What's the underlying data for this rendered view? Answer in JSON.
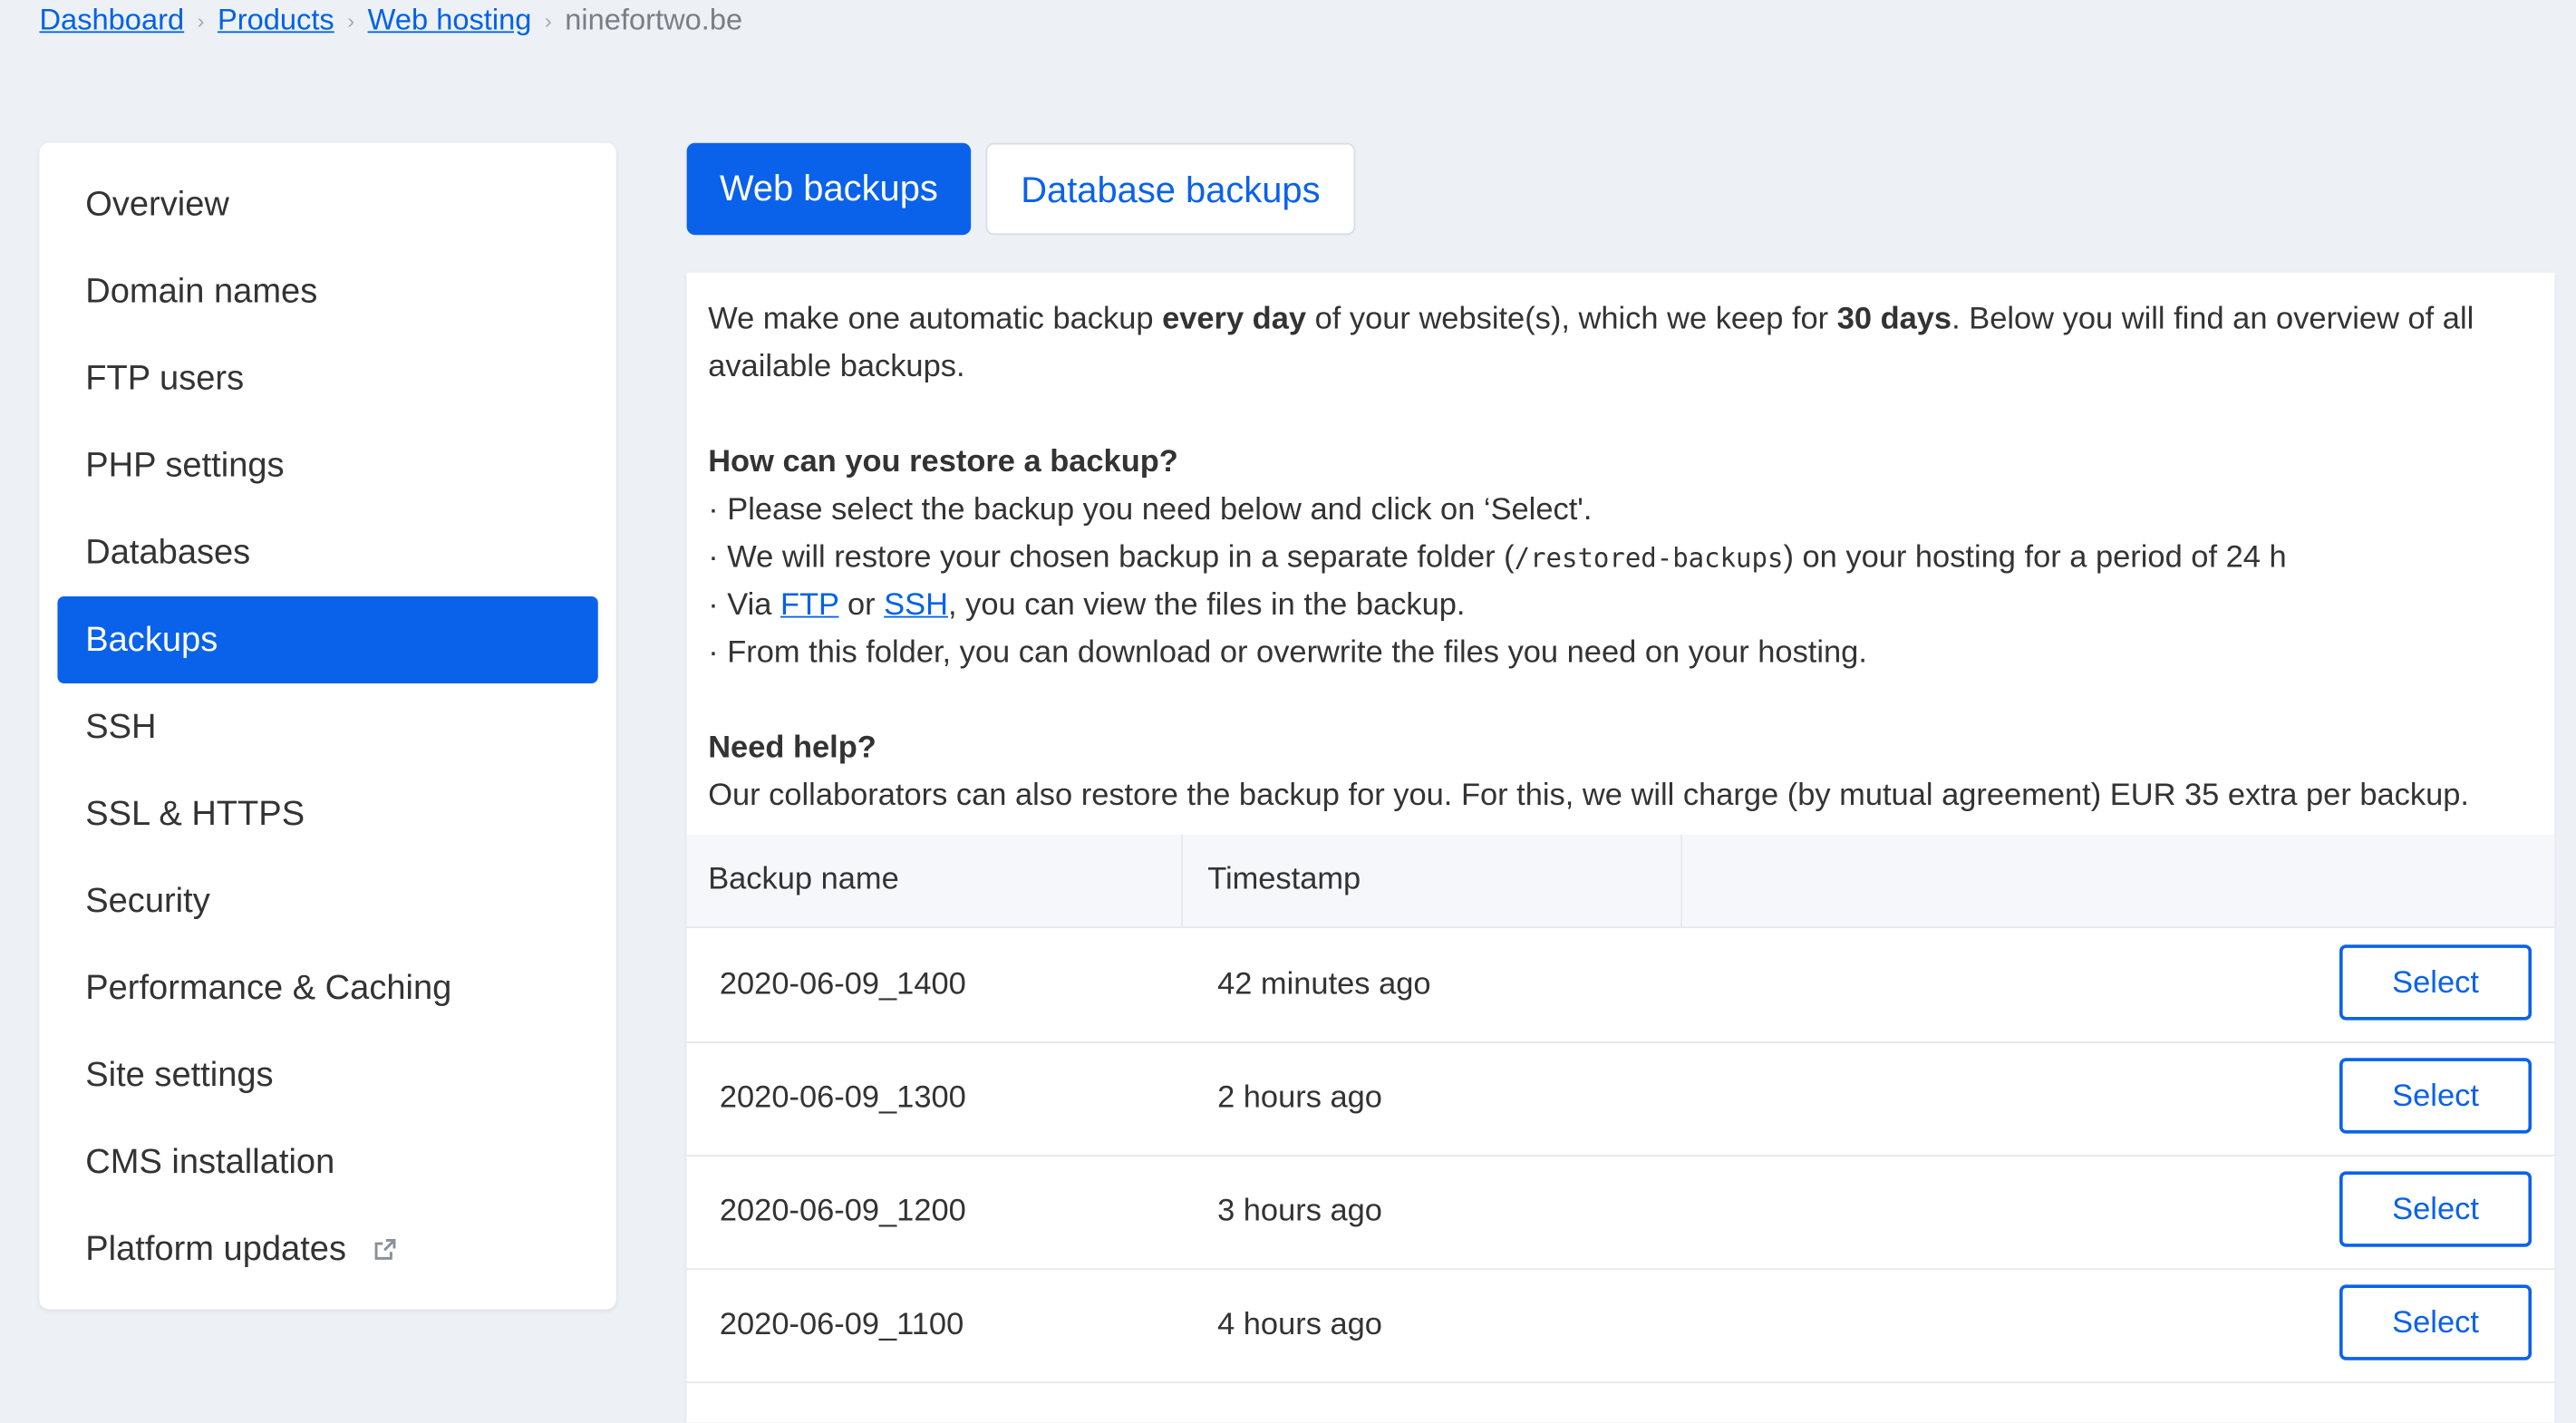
{
  "breadcrumb": {
    "items": [
      "Dashboard",
      "Products",
      "Web hosting"
    ],
    "current": "ninefortwo.be"
  },
  "sidebar": {
    "items": [
      {
        "label": "Overview"
      },
      {
        "label": "Domain names"
      },
      {
        "label": "FTP users"
      },
      {
        "label": "PHP settings"
      },
      {
        "label": "Databases"
      },
      {
        "label": "Backups",
        "active": true
      },
      {
        "label": "SSH"
      },
      {
        "label": "SSL & HTTPS"
      },
      {
        "label": "Security"
      },
      {
        "label": "Performance & Caching"
      },
      {
        "label": "Site settings"
      },
      {
        "label": "CMS installation"
      },
      {
        "label": "Platform updates",
        "icon": "external-link-icon"
      }
    ]
  },
  "tabs": [
    {
      "label": "Web backups",
      "active": true
    },
    {
      "label": "Database backups",
      "active": false
    }
  ],
  "info": {
    "intro_1": "We make one automatic backup ",
    "intro_bold_1": "every day",
    "intro_2": " of your website(s), which we keep for ",
    "intro_bold_2": "30 days",
    "intro_3": ". Below you will find an overview of all available backups.",
    "restore_heading": "How can you restore a backup?",
    "restore_line1": "· Please select the backup you need below and click on ‘Select'.",
    "restore_line2_a": "· We will restore your chosen backup in a separate folder (",
    "restore_line2_code": "/restored-backups",
    "restore_line2_b": ") on your hosting for a period of 24 h",
    "restore_line3_a": "· Via ",
    "restore_line3_ftp": "FTP",
    "restore_line3_or": " or ",
    "restore_line3_ssh": "SSH",
    "restore_line3_b": ", you can view the files in the backup.",
    "restore_line4": "· From this folder, you can download or overwrite the files you need on your hosting.",
    "help_heading": "Need help?",
    "help_text": "Our collaborators can also restore the backup for you. For this, we will charge (by mutual agreement) EUR 35 extra per backup."
  },
  "table": {
    "headers": [
      "Backup name",
      "Timestamp",
      ""
    ],
    "select_label": "Select",
    "rows": [
      {
        "name": "2020-06-09_1400",
        "time": "42 minutes ago"
      },
      {
        "name": "2020-06-09_1300",
        "time": "2 hours ago"
      },
      {
        "name": "2020-06-09_1200",
        "time": "3 hours ago"
      },
      {
        "name": "2020-06-09_1100",
        "time": "4 hours ago"
      }
    ]
  },
  "colors": {
    "accent": "#0a62ea",
    "link": "#0062e6",
    "background": "#edf1f6"
  }
}
